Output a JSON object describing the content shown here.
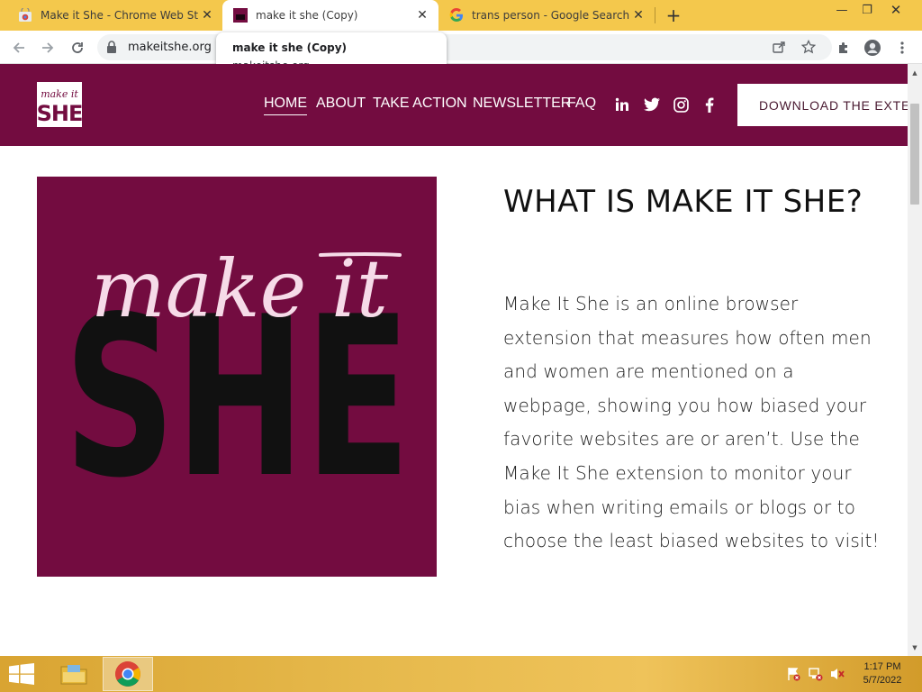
{
  "browser": {
    "tabs": [
      {
        "title": "Make it She - Chrome Web Store",
        "favicon": "chrome-web-store-icon",
        "active": false
      },
      {
        "title": "make it she (Copy)",
        "favicon": "make-it-she-favicon",
        "active": true
      },
      {
        "title": "trans person - Google Search",
        "favicon": "google-icon",
        "active": false
      }
    ],
    "tooltip": {
      "title": "make it she (Copy)",
      "url": "makeitshe.org"
    },
    "address": "makeitshe.org"
  },
  "site": {
    "logo_small_top": "make it",
    "logo_small_bottom": "SHE",
    "nav": [
      "HOME",
      "ABOUT",
      "TAKE ACTION",
      "NEWSLETTER",
      "FAQ"
    ],
    "social": [
      "linkedin-icon",
      "twitter-icon",
      "instagram-icon",
      "facebook-icon"
    ],
    "download_label": "DOWNLOAD THE EXTENSION",
    "hero_script": "make it",
    "hero_block": "SHE",
    "heading": "WHAT IS MAKE IT SHE?",
    "body": "Make It She is an online browser extension that measures how often men and women are mentioned on a webpage, showing you how biased your favorite websites are or aren’t. Use the Make It She extension to monitor your bias when writing emails or blogs or to choose the least biased websites to visit!"
  },
  "taskbar": {
    "time": "1:17 PM",
    "date": "5/7/2022"
  },
  "colors": {
    "brand": "#730c40",
    "tabstrip": "#f4c84c"
  }
}
